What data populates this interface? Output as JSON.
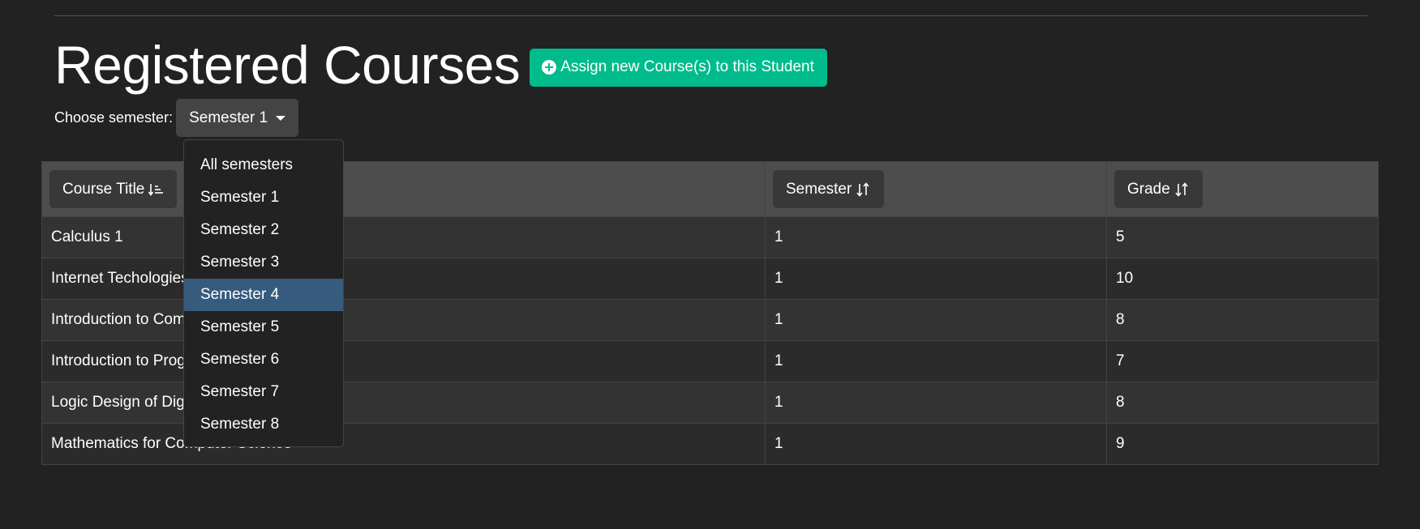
{
  "page": {
    "title": "Registered Courses"
  },
  "actions": {
    "assign_label": "Assign new Course(s) to this Student"
  },
  "semester_filter": {
    "label": "Choose semester:",
    "selected": "Semester 1",
    "options": [
      "All semesters",
      "Semester 1",
      "Semester 2",
      "Semester 3",
      "Semester 4",
      "Semester 5",
      "Semester 6",
      "Semester 7",
      "Semester 8"
    ],
    "highlighted": "Semester 4"
  },
  "table": {
    "headers": {
      "course_title": "Course Title",
      "semester": "Semester",
      "grade": "Grade"
    },
    "rows": [
      {
        "course": "Calculus 1",
        "semester": "1",
        "grade": "5"
      },
      {
        "course": "Internet Techologies",
        "semester": "1",
        "grade": "10"
      },
      {
        "course": "Introduction to Computer Science",
        "semester": "1",
        "grade": "8"
      },
      {
        "course": "Introduction to Programming",
        "semester": "1",
        "grade": "7"
      },
      {
        "course": "Logic Design of Digital Systems",
        "semester": "1",
        "grade": "8"
      },
      {
        "course": "Mathematics for Computer Science",
        "semester": "1",
        "grade": "9"
      }
    ]
  },
  "icons": {
    "assign": "plus-circle-icon",
    "sort_title": "sort-alpha-down-icon",
    "sort_other": "sort-arrows-icon",
    "dropdown": "caret-down-icon"
  },
  "colors": {
    "background": "#222222",
    "success": "#00bc8c",
    "highlight": "#375a7f",
    "header": "#4d4d4d"
  }
}
